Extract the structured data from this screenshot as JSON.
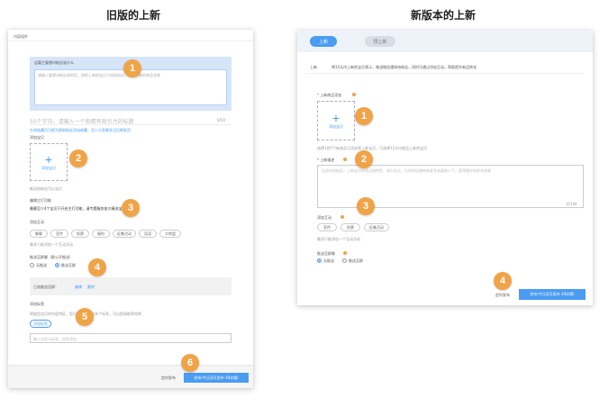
{
  "captions": {
    "old": "旧版的上新",
    "new": "新版本的上新"
  },
  "old_panel": {
    "title": "内容组件",
    "blue_box_title": "这篇主要想对粉丝说什么",
    "blue_box_placeholder": "请输入要想对粉丝说的话，如把上新的宝贝介绍给粉丝，最近上新的商品名称",
    "title_hint": "50个字内，请输入一个吸睛有吸引力的标题",
    "char_count": "0/50",
    "link_text": "在线收藏页可视为帮助粉丝添加收藏，至少大家都关注后期发货",
    "add_image_label": "添加宝贝",
    "upload_label": "添加宝贝",
    "image_hint": "推送给粉丝可以宝贝",
    "cover_label": "编辑主打功能",
    "cover_desc": "最最至少4个宝贝只开启主打功能，请专题服务各大精选宝贝",
    "interact_label": "添加互动",
    "chips": [
      "聊聊",
      "宣传",
      "投票",
      "福利",
      "征集活动",
      "话语",
      "大转盘"
    ],
    "interact_hint": "最多只能添加一个互动活动",
    "push_label": "推送至群聊（群公开推送）",
    "radio_no": "无推送",
    "radio_yes": "推送至群",
    "selected_group": "已选推送至群：",
    "group_link1": "编辑",
    "group_link2": "删除",
    "tag_label": "添加标签",
    "tag_hint": "根据您宝贝的内容特征，您可以添加一到多个标签，可以提高推荐效果",
    "tag_btn": "添加标签",
    "tag_input": "输入自定义标签，回车添加",
    "timed_label": "定时发布",
    "publish_btn": "发布(今日还可发布 49次哦)"
  },
  "new_panel": {
    "tab_active": "上新",
    "tab_inactive": "预上新",
    "desc_prefix": "上新",
    "desc": "将15天内上新的宝贝表示，推送微信通知给粉丝，同时可通过添加互动，帮助提升新品转化",
    "product_label": "* 上新商品添加",
    "upload_label": "添加宝贝",
    "product_hint": "选择1到7个新商品可添加到上新宝贝，可选择15天内商品上新的宝贝",
    "desc_label": "* 上新描述",
    "desc_placeholder": "告诉你的粉丝，上新宝贝的亮点和特色，吸引关注，为你的店铺带来更多流量和人气，获得更好的转化效果",
    "desc_count": "0/144",
    "interact_label": "添加互动",
    "chips": [
      "宣传",
      "投票",
      "征集活动"
    ],
    "interact_hint": "最多只能添加一个互动活动",
    "push_label": "推送至群聊",
    "radio_no": "无推送",
    "radio_yes": "推送至群",
    "timed_label": "定时发布",
    "publish_btn": "发布(今日还可发布 49次哦)"
  },
  "old_badges": [
    "1",
    "2",
    "3",
    "4",
    "5",
    "6"
  ],
  "new_badges": [
    "1",
    "2",
    "3",
    "4"
  ]
}
